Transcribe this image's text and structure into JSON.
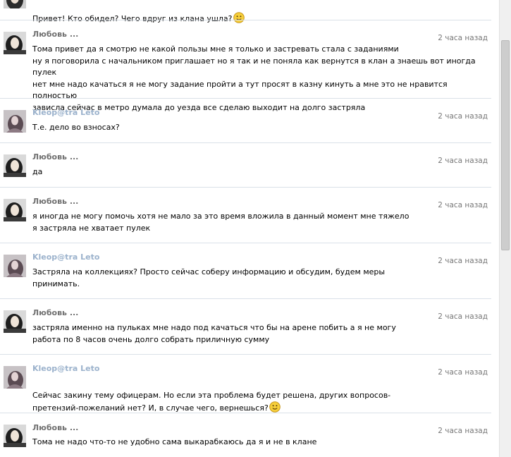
{
  "messages": [
    {
      "author": "",
      "time": "",
      "text": "Привет! Кто обидел? Чего вдруг из клана ушла?",
      "smiley": true,
      "kind": "lub"
    },
    {
      "author": "Любовь ...",
      "time": "2 часа назад",
      "text": "Тома привет да я смотрю не какой пользы мне я только и застревать стала с заданиями\nну я поговорила с начальником приглашает но я так и не поняла как вернутся в клан а знаешь вот иногда пулек\nнет мне надо качаться я не могу задание пройти а тут просят в казну кинуть а мне это не нравится полностью\nзависла сейчас в метро думала до уезда все сделаю выходит на долго застряла",
      "smiley": false,
      "kind": "lub"
    },
    {
      "author": "Kleop@tra Leto",
      "time": "2 часа назад",
      "text": "Т.е. дело во взносах?",
      "smiley": false,
      "kind": "kl"
    },
    {
      "author": "Любовь ...",
      "time": "2 часа назад",
      "text": "да",
      "smiley": false,
      "kind": "lub"
    },
    {
      "author": "Любовь ...",
      "time": "2 часа назад",
      "text": "я иногда не могу помочь хотя не мало за это время вложила в данный момент мне тяжело\nя застряла не хватает пулек",
      "smiley": false,
      "kind": "lub"
    },
    {
      "author": "Kleop@tra Leto",
      "time": "2 часа назад",
      "text": "Застряла на коллекциях? Просто сейчас соберу информацию и обсудим, будем меры\nпринимать.",
      "smiley": false,
      "kind": "kl"
    },
    {
      "author": "Любовь ...",
      "time": "2 часа назад",
      "text": "застряла именно на пульках мне надо под качаться что бы на арене побить а я не могу\nработа по 8 часов очень долго собрать приличную сумму",
      "smiley": false,
      "kind": "lub"
    },
    {
      "author": "Kleop@tra Leto",
      "time": "2 часа назад",
      "text": "Сейчас закину тему офицерам. Но если эта проблема будет решена, других вопросов-\nпретензий-пожеланий нет? И, в случае чего, вернешься?",
      "smiley": true,
      "kind": "kl"
    },
    {
      "author": "Любовь ...",
      "time": "2 часа назад",
      "text": "Тома не надо что-то не удобно сама выкарабкаюсь да я и не в клане",
      "smiley": false,
      "kind": "lub"
    }
  ]
}
